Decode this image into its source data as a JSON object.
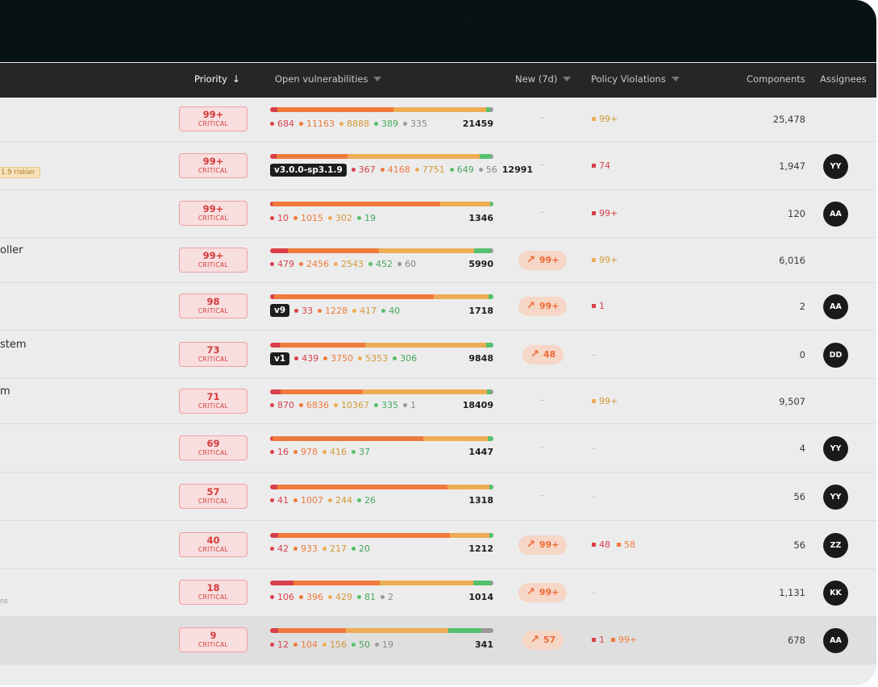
{
  "columns": {
    "priority": "Priority",
    "open_vulnerabilities": "Open vulnerabilities",
    "new_7d": "New (7d)",
    "policy_violations": "Policy Violations",
    "components": "Components",
    "assignees": "Assignees"
  },
  "colors": {
    "critical": "#d9404b",
    "high": "#f07a3c",
    "medium": "#eeac55",
    "low": "#55c06d",
    "unknown": "#9a9a9a"
  },
  "rows": [
    {
      "name": "",
      "sub": "",
      "riskier": "",
      "priority": "99+",
      "level": "CRITICAL",
      "tag": "",
      "counts": {
        "critical": "684",
        "high": "11163",
        "medium": "8888",
        "low": "389",
        "unknown": "335"
      },
      "total": "21459",
      "new": "–",
      "violations": [
        {
          "color": "yellow",
          "value": "99+"
        }
      ],
      "components": "25,478",
      "assignee": ""
    },
    {
      "name": "",
      "sub": "",
      "riskier": "1.9 riskier",
      "priority": "99+",
      "level": "CRITICAL",
      "tag": "v3.0.0-sp3.1.9",
      "counts": {
        "critical": "367",
        "high": "4168",
        "medium": "7751",
        "low": "649",
        "unknown": "56"
      },
      "total": "12991",
      "new": "–",
      "violations": [
        {
          "color": "red",
          "value": "74"
        }
      ],
      "components": "1,947",
      "assignee": "YY"
    },
    {
      "name": "",
      "sub": "",
      "riskier": "",
      "priority": "99+",
      "level": "CRITICAL",
      "tag": "",
      "counts": {
        "critical": "10",
        "high": "1015",
        "medium": "302",
        "low": "19",
        "unknown": ""
      },
      "total": "1346",
      "new": "–",
      "violations": [
        {
          "color": "red",
          "value": "99+"
        }
      ],
      "components": "120",
      "assignee": "AA"
    },
    {
      "name": "oller",
      "sub": "",
      "riskier": "",
      "priority": "99+",
      "level": "CRITICAL",
      "tag": "",
      "counts": {
        "critical": "479",
        "high": "2456",
        "medium": "2543",
        "low": "452",
        "unknown": "60"
      },
      "total": "5990",
      "new": "99+",
      "violations": [
        {
          "color": "yellow",
          "value": "99+"
        }
      ],
      "components": "6,016",
      "assignee": ""
    },
    {
      "name": "",
      "sub": "",
      "riskier": "",
      "priority": "98",
      "level": "CRITICAL",
      "tag": "v9",
      "counts": {
        "critical": "33",
        "high": "1228",
        "medium": "417",
        "low": "40",
        "unknown": ""
      },
      "total": "1718",
      "new": "99+",
      "violations": [
        {
          "color": "red",
          "value": "1"
        }
      ],
      "components": "2",
      "assignee": "AA"
    },
    {
      "name": "stem",
      "sub": "",
      "riskier": "",
      "priority": "73",
      "level": "CRITICAL",
      "tag": "v1",
      "counts": {
        "critical": "439",
        "high": "3750",
        "medium": "5353",
        "low": "306",
        "unknown": ""
      },
      "total": "9848",
      "new": "48",
      "violations": [],
      "components": "0",
      "assignee": "DD"
    },
    {
      "name": "m",
      "sub": "",
      "riskier": "",
      "priority": "71",
      "level": "CRITICAL",
      "tag": "",
      "counts": {
        "critical": "870",
        "high": "6836",
        "medium": "10367",
        "low": "335",
        "unknown": "1"
      },
      "total": "18409",
      "new": "–",
      "violations": [
        {
          "color": "yellow",
          "value": "99+"
        }
      ],
      "components": "9,507",
      "assignee": ""
    },
    {
      "name": "",
      "sub": "",
      "riskier": "",
      "priority": "69",
      "level": "CRITICAL",
      "tag": "",
      "counts": {
        "critical": "16",
        "high": "978",
        "medium": "416",
        "low": "37",
        "unknown": ""
      },
      "total": "1447",
      "new": "–",
      "violations": [],
      "components": "4",
      "assignee": "YY"
    },
    {
      "name": "",
      "sub": "",
      "riskier": "",
      "priority": "57",
      "level": "CRITICAL",
      "tag": "",
      "counts": {
        "critical": "41",
        "high": "1007",
        "medium": "244",
        "low": "26",
        "unknown": ""
      },
      "total": "1318",
      "new": "–",
      "violations": [],
      "components": "56",
      "assignee": "YY"
    },
    {
      "name": "",
      "sub": "",
      "riskier": "",
      "priority": "40",
      "level": "CRITICAL",
      "tag": "",
      "counts": {
        "critical": "42",
        "high": "933",
        "medium": "217",
        "low": "20",
        "unknown": ""
      },
      "total": "1212",
      "new": "99+",
      "violations": [
        {
          "color": "red",
          "value": "48"
        },
        {
          "color": "orange",
          "value": "58"
        }
      ],
      "components": "56",
      "assignee": "ZZ"
    },
    {
      "name": "",
      "sub": "ns",
      "riskier": "",
      "priority": "18",
      "level": "CRITICAL",
      "tag": "",
      "counts": {
        "critical": "106",
        "high": "396",
        "medium": "429",
        "low": "81",
        "unknown": "2"
      },
      "total": "1014",
      "new": "99+",
      "violations": [],
      "components": "1,131",
      "assignee": "KK"
    },
    {
      "name": "",
      "sub": "",
      "riskier": "",
      "priority": "9",
      "level": "CRITICAL",
      "tag": "",
      "counts": {
        "critical": "12",
        "high": "104",
        "medium": "156",
        "low": "50",
        "unknown": "19"
      },
      "total": "341",
      "new": "57",
      "violations": [
        {
          "color": "red",
          "value": "1"
        },
        {
          "color": "orange",
          "value": "99+"
        }
      ],
      "components": "678",
      "assignee": "AA"
    }
  ]
}
